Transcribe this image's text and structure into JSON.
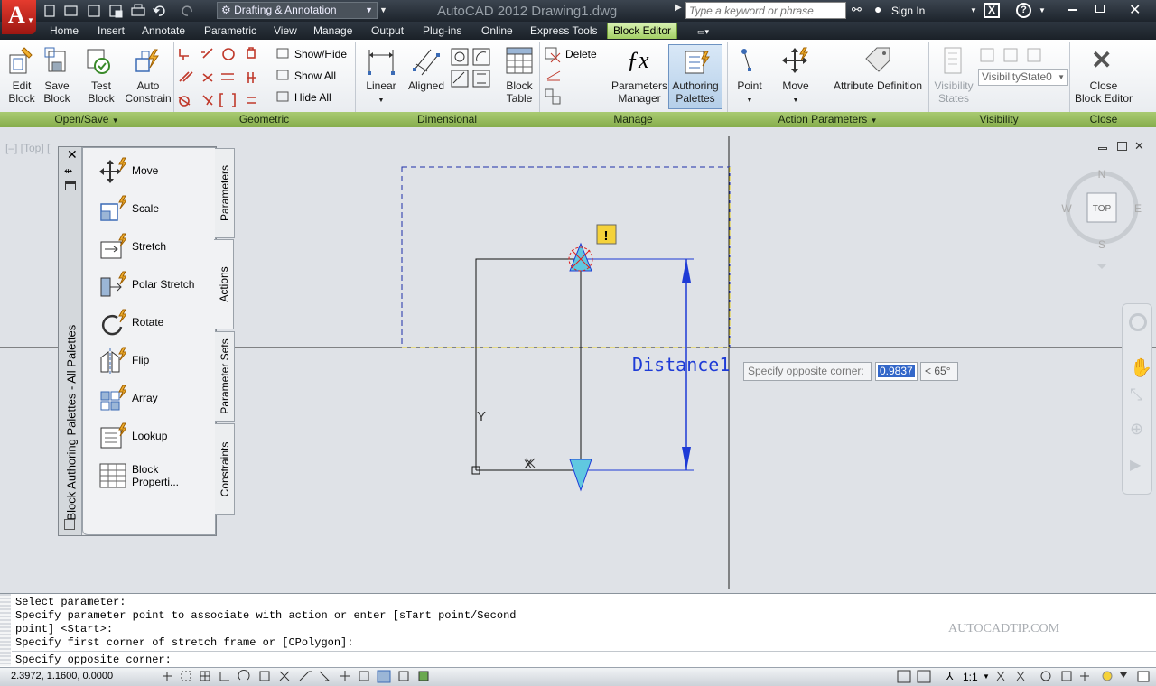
{
  "titlebar": {
    "workspace": "Drafting & Annotation",
    "title": "AutoCAD 2012    Drawing1.dwg",
    "search_placeholder": "Type a keyword or phrase",
    "signin": "Sign In"
  },
  "ribbon_tabs": [
    "Home",
    "Insert",
    "Annotate",
    "Parametric",
    "View",
    "Manage",
    "Output",
    "Plug-ins",
    "Online",
    "Express Tools",
    "Block Editor"
  ],
  "ribbon": {
    "edit_block": "Edit\nBlock",
    "save_block": "Save\nBlock",
    "test_block": "Test\nBlock",
    "auto_constrain": "Auto\nConstrain",
    "show_hide": "Show/Hide",
    "show_all": "Show All",
    "hide_all": "Hide All",
    "linear": "Linear",
    "aligned": "Aligned",
    "block_table": "Block\nTable",
    "delete": "Delete",
    "parameters_manager": "Parameters\nManager",
    "authoring_palettes": "Authoring\nPalettes",
    "point": "Point",
    "move": "Move",
    "attribute_definition": "Attribute Definition",
    "visibility_states": "Visibility\nStates",
    "visibility_state_value": "VisibilityState0",
    "close_block_editor": "Close\nBlock Editor"
  },
  "panels": {
    "open_save": "Open/Save",
    "geometric": "Geometric",
    "dimensional": "Dimensional",
    "manage": "Manage",
    "action_parameters": "Action Parameters",
    "visibility": "Visibility",
    "close": "Close"
  },
  "viewport_label": "[–] [Top] [",
  "palette": {
    "title": "Block Authoring Palettes - All Palettes",
    "tabs": [
      "Parameters",
      "Actions",
      "Parameter Sets",
      "Constraints"
    ],
    "items": [
      "Move",
      "Scale",
      "Stretch",
      "Polar Stretch",
      "Rotate",
      "Flip",
      "Array",
      "Lookup",
      "Block\nProperti..."
    ]
  },
  "drawing": {
    "distance_label": "Distance1",
    "x_label": "X",
    "y_label": "Y"
  },
  "dynamic_input": {
    "prompt": "Specify opposite corner:",
    "value": "0.9837",
    "angle": "< 65°"
  },
  "viewcube": {
    "top": "TOP",
    "n": "N",
    "s": "S",
    "e": "E",
    "w": "W"
  },
  "command_history": [
    "Select parameter:",
    "Specify parameter point to associate with action or enter [sTart point/Second",
    "point] <Start>:",
    "Specify first corner of stretch frame or [CPolygon]:"
  ],
  "command_prompt": "Specify opposite corner:",
  "watermark": "AUTOCADTIP.COM",
  "status": {
    "coords": "2.3972, 1.1600, 0.0000",
    "scale": "1:1"
  }
}
